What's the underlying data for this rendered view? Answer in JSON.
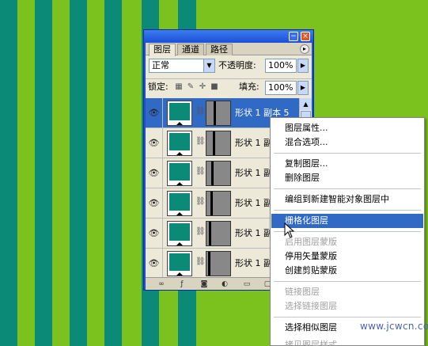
{
  "colors": {
    "background": "#7cc21e",
    "stripe": "#0b8a78",
    "selection": "#316ac5",
    "panel_bg": "#ece9d8"
  },
  "panel": {
    "tabs": [
      {
        "label": "图层"
      },
      {
        "label": "通道"
      },
      {
        "label": "路径"
      }
    ],
    "blend_mode": "正常",
    "opacity_label": "不透明度:",
    "opacity_value": "100%",
    "lock_label": "锁定:",
    "fill_label": "填充:",
    "fill_value": "100%",
    "layers": [
      {
        "name": "形状 1 副本 5"
      },
      {
        "name": "形状 1 副"
      },
      {
        "name": "形状 1 副"
      },
      {
        "name": "形状 1 副"
      },
      {
        "name": "形状 1 副"
      },
      {
        "name": "形状 1 副"
      }
    ]
  },
  "context_menu": {
    "items": [
      {
        "label": "图层属性..."
      },
      {
        "label": "混合选项..."
      },
      {
        "label": "复制图层..."
      },
      {
        "label": "删除图层"
      },
      {
        "label": "编组到新建智能对象图层中"
      },
      {
        "label": "栅格化图层"
      },
      {
        "label": "启用图层蒙版"
      },
      {
        "label": "停用矢量蒙版"
      },
      {
        "label": "创建剪贴蒙版"
      },
      {
        "label": "链接图层"
      },
      {
        "label": "选择链接图层"
      },
      {
        "label": "选择相似图层"
      },
      {
        "label": "拷贝图层样式"
      }
    ]
  },
  "watermark": "www.jcwcn.com"
}
